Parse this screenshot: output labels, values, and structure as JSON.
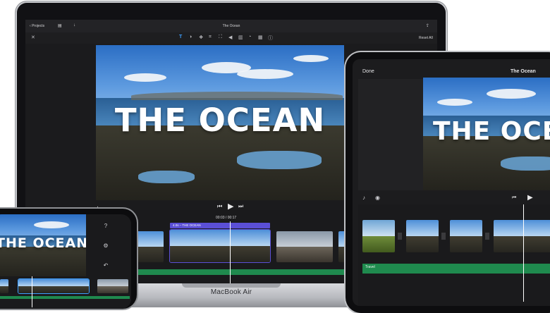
{
  "colors": {
    "accent": "#3ea0ff",
    "clip_label": "#5b4fd6",
    "audio": "#1f8a4e",
    "timeline_bg": "#1a1a1c"
  },
  "mac": {
    "model_label": "MacBook Air",
    "topbar": {
      "back_label": "Projects",
      "project_title": "The Ocean",
      "share_icon": "share-icon",
      "undo_icon": "undo-icon"
    },
    "toolbar": {
      "reset_label": "Reset All",
      "tools": [
        "title-icon",
        "color-icon",
        "filter-icon",
        "crop-icon",
        "stabilize-icon",
        "volume-icon",
        "equalizer-icon",
        "speed-icon",
        "noise-icon",
        "info-icon"
      ]
    },
    "preview": {
      "title_text": "THE OCEAN"
    },
    "timecode": {
      "current": "00:03",
      "total": "00:17"
    },
    "clip_label": "4.0s – THE OCEAN"
  },
  "ipad": {
    "done_label": "Done",
    "project_title": "The Ocean",
    "preview": {
      "title_text": "THE OCEAN"
    },
    "audio_label": "Travel"
  },
  "iphone": {
    "preview": {
      "title_text": "THE OCEAN"
    }
  }
}
